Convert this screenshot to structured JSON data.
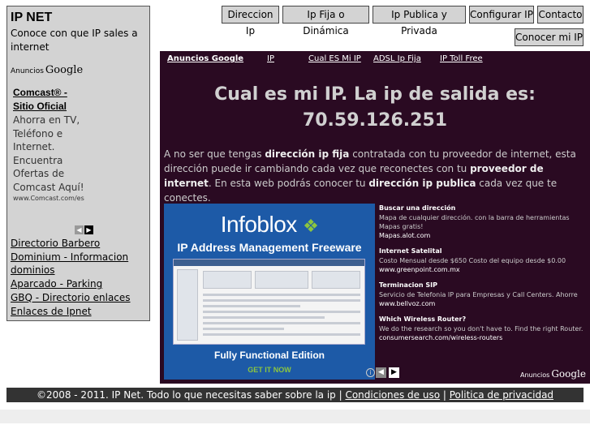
{
  "sidebar": {
    "title": "IP NET",
    "subtitle": "Conoce con que IP sales a internet",
    "ads_label": "Anuncios",
    "ads_brand": "Google",
    "ad": {
      "title": "Comcast® - Sitio Oficial",
      "text": "Ahorra en TV, Teléfono e Internet. Encuentra Ofertas de Comcast Aquí!",
      "url": "www.Comcast.com/es"
    },
    "arrows": {
      "prev": "◀",
      "next": "▶"
    },
    "links": [
      "Directorio Barbero",
      "Dominium - Informacion dominios",
      "Aparcado - Parking",
      "GBQ - Directorio enlaces",
      "Enlaces de Ipnet"
    ]
  },
  "nav": {
    "items": [
      "Direccion Ip",
      "Ip Fija o Dinámica",
      "Ip Publica y Privada",
      "Configurar IP",
      "Contacto",
      "Conocer mi IP"
    ]
  },
  "main": {
    "link_bar": [
      "Anuncios Google",
      "IP",
      "Cual ES Mi IP",
      "ADSL Ip Fija",
      "IP Toll Free"
    ],
    "headline": "Cual es mi IP. La ip de salida es:",
    "ip": "70.59.126.251",
    "intro": {
      "p1": "A no ser que tengas ",
      "b1": "dirección ip fija",
      "p2": " contratada con tu proveedor de internet, esta dirección puede ir cambiando cada vez que reconectes con tu ",
      "b2": "proveedor de internet",
      "p3": ". En esta web podrás conocer tu ",
      "b3": "dirección ip publica",
      "p4": " cada vez que te conectes."
    },
    "banner": {
      "logo": "Infoblox",
      "logo_mark": "❖",
      "title": "IP Address Management Freeware",
      "edition": "Fully Functional Edition",
      "cta": "GET IT NOW",
      "info_icon": "i"
    },
    "text_ads": [
      {
        "title": "Buscar una dirección",
        "desc": "Mapa de cualquier dirección. con la barra de herramientas Mapas gratis!",
        "url": "Mapas.alot.com"
      },
      {
        "title": "Internet Satelital",
        "desc": "Costo Mensual desde $650 Costo del equipo desde $0.00",
        "url": "www.greenpoint.com.mx"
      },
      {
        "title": "Terminacion SIP",
        "desc": "Servicio de Telefonia IP para Empresas y Call Centers. Ahorre",
        "url": "www.bellvoz.com"
      },
      {
        "title": "Which Wireless Router?",
        "desc": "We do the research so you don't have to. Find the right Router.",
        "url": "consumersearch.com/wireless-routers"
      }
    ],
    "ads_arrows": {
      "prev": "◀",
      "next": "▶"
    },
    "ads_label": "Anuncios",
    "ads_brand": "Google"
  },
  "footer": {
    "text": "©2008 - 2011. IP Net. Todo lo que necesitas saber sobre la ip | ",
    "link1": "Condiciones de uso",
    "sep": " | ",
    "link2": "Politica de privacidad"
  }
}
